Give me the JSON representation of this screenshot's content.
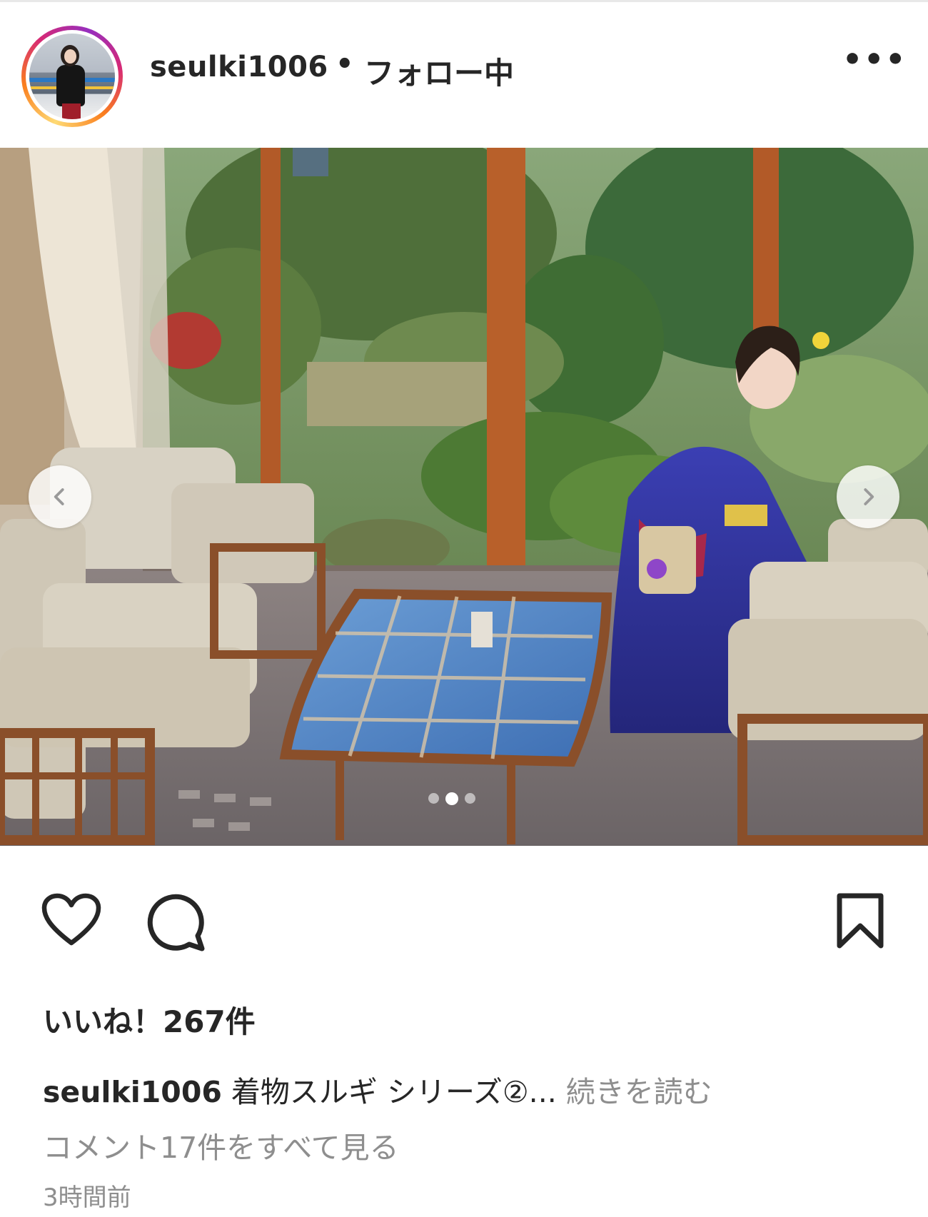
{
  "post": {
    "username": "seulki1006",
    "separator": "•",
    "follow_status": "フォロー中",
    "more_label": "•••",
    "likes_text": "いいね！267件",
    "caption_user": "seulki1006",
    "caption_text": " 着物スルギ シリーズ②...",
    "caption_more": " 続きを読む",
    "view_comments": "コメント17件をすべて見る",
    "timestamp": "3時間前"
  },
  "carousel": {
    "current_index": 2,
    "total": 3
  },
  "icons": {
    "like": "heart-icon",
    "comment": "comment-bubble-icon",
    "save": "bookmark-icon",
    "more": "more-horizontal-icon",
    "prev": "chevron-left-icon",
    "next": "chevron-right-icon"
  }
}
